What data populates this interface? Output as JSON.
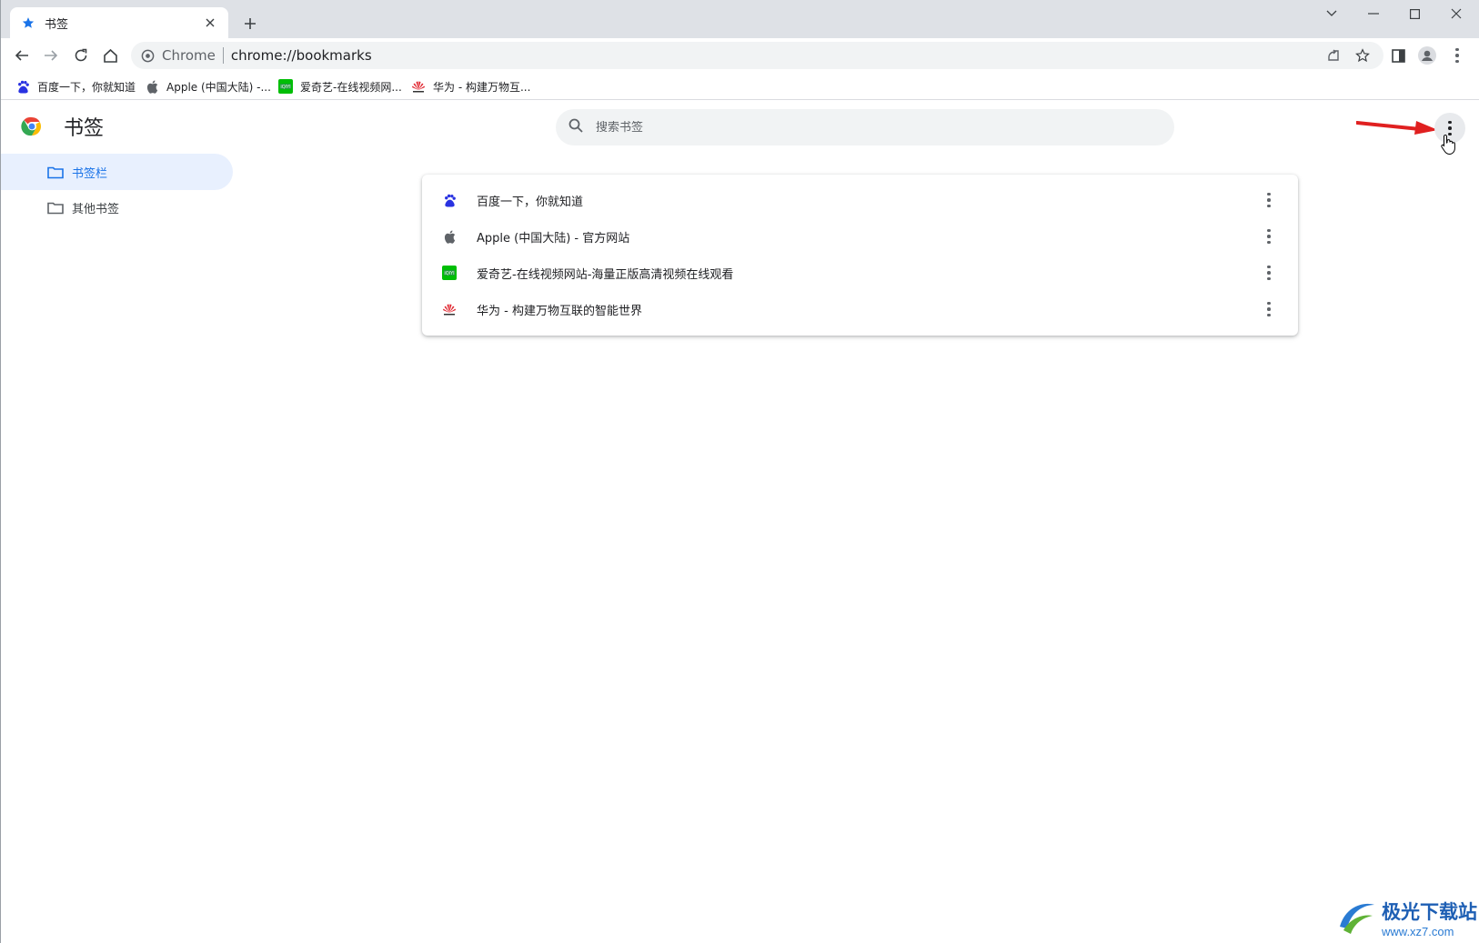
{
  "tab": {
    "title": "书签"
  },
  "omnibox": {
    "site_chip": "Chrome",
    "url": "chrome://bookmarks"
  },
  "bookmarks_bar": [
    {
      "label": "百度一下，你就知道",
      "icon": "baidu-icon"
    },
    {
      "label": "Apple (中国大陆) -...",
      "icon": "apple-icon"
    },
    {
      "label": "爱奇艺-在线视频网...",
      "icon": "iqiyi-icon"
    },
    {
      "label": "华为 - 构建万物互...",
      "icon": "huawei-icon"
    }
  ],
  "page": {
    "title": "书签",
    "search_placeholder": "搜索书签"
  },
  "sidebar": [
    {
      "label": "书签栏",
      "active": true
    },
    {
      "label": "其他书签",
      "active": false
    }
  ],
  "bookmarks": [
    {
      "label": "百度一下，你就知道",
      "icon": "baidu-icon"
    },
    {
      "label": "Apple (中国大陆) - 官方网站",
      "icon": "apple-icon"
    },
    {
      "label": "爱奇艺-在线视频网站-海量正版高清视频在线观看",
      "icon": "iqiyi-icon"
    },
    {
      "label": "华为 - 构建万物互联的智能世界",
      "icon": "huawei-icon"
    }
  ],
  "watermark": {
    "name": "极光下载站",
    "url": "www.xz7.com"
  },
  "colors": {
    "accent": "#1a73e8",
    "active_bg": "#e8f0fe",
    "arrow": "#e02020",
    "tabstrip": "#dee1e6"
  }
}
